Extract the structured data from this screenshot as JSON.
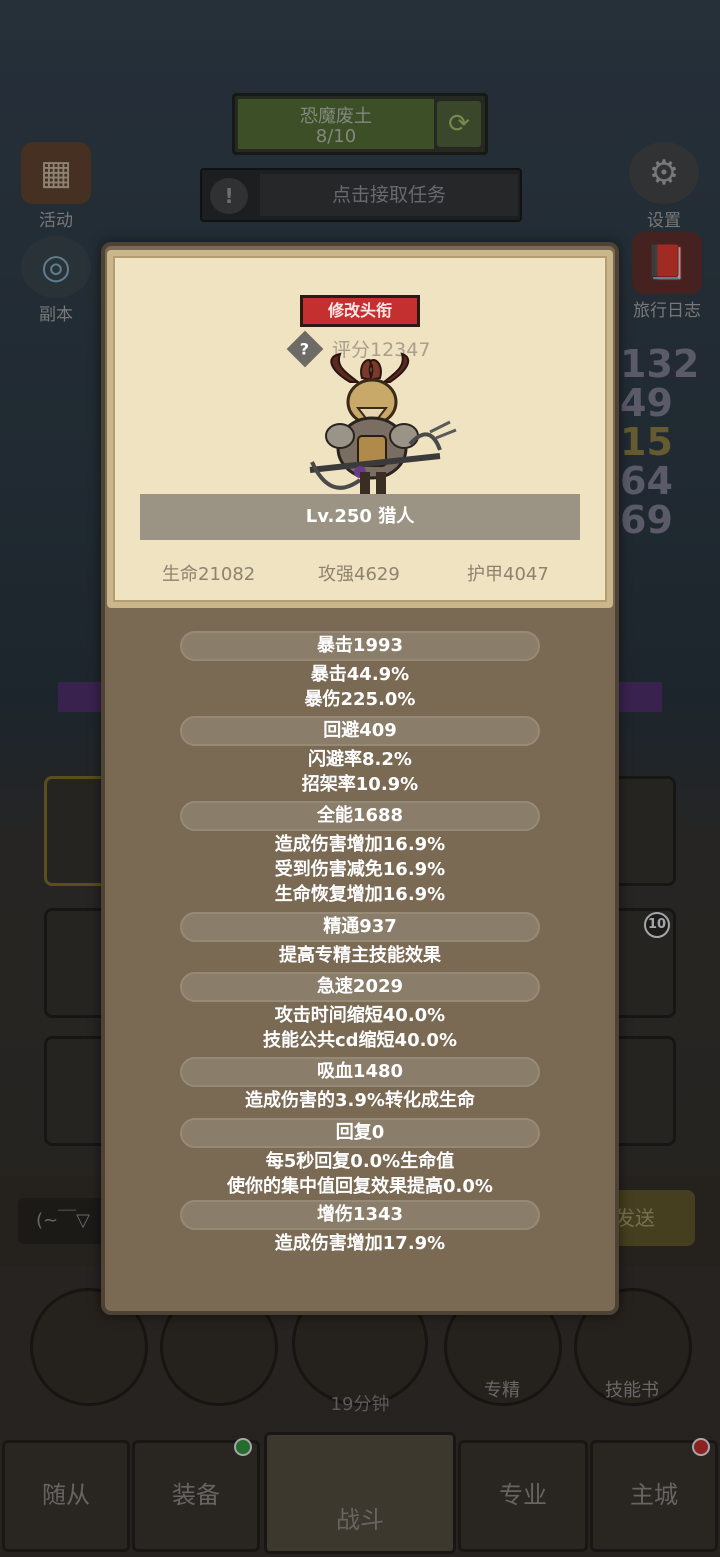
{
  "background": {
    "zone": {
      "name": "恐魔废土",
      "progress": "8/10"
    },
    "quest": {
      "warn": "!",
      "text": "点击接取任务"
    },
    "left_icons": [
      {
        "label": "活动"
      },
      {
        "label": "副本"
      }
    ],
    "right_icons": [
      {
        "label": "设置"
      },
      {
        "label": "旅行日志"
      }
    ],
    "side_numbers": [
      "132",
      "49",
      "15",
      "64",
      "69"
    ],
    "chat": {
      "input_text": "(~￣▽",
      "send_label": "发送"
    },
    "actions": [
      {
        "label": ""
      },
      {
        "label": ""
      },
      {
        "label": "19分钟"
      },
      {
        "label": "专精"
      },
      {
        "label": "技能书"
      }
    ],
    "slot_badge": "10",
    "tabs": [
      {
        "label": "随从"
      },
      {
        "label": "装备"
      },
      {
        "label": "战斗"
      },
      {
        "label": "专业"
      },
      {
        "label": "主城"
      }
    ],
    "colors": {
      "accent_red": "#c43030",
      "panel": "#7a6a54",
      "card": "#efe3c2"
    }
  },
  "hero": {
    "change_title_label": "修改头衔",
    "help_icon": "?",
    "score": "评分12347",
    "level_class": "Lv.250 猎人",
    "base_stats": {
      "hp": "生命21082",
      "attack": "攻强4629",
      "armor": "护甲4047"
    }
  },
  "stats": [
    {
      "header": "暴击1993",
      "lines": [
        "暴击44.9%",
        "暴伤225.0%"
      ]
    },
    {
      "header": "回避409",
      "lines": [
        "闪避率8.2%",
        "招架率10.9%"
      ]
    },
    {
      "header": "全能1688",
      "lines": [
        "造成伤害增加16.9%",
        "受到伤害减免16.9%",
        "生命恢复增加16.9%"
      ]
    },
    {
      "header": "精通937",
      "lines": [
        "提高专精主技能效果"
      ]
    },
    {
      "header": "急速2029",
      "lines": [
        "攻击时间缩短40.0%",
        "技能公共cd缩短40.0%"
      ]
    },
    {
      "header": "吸血1480",
      "lines": [
        "造成伤害的3.9%转化成生命"
      ]
    },
    {
      "header": "回复0",
      "lines": [
        "每5秒回复0.0%生命值",
        "使你的集中值回复效果提高0.0%"
      ]
    },
    {
      "header": "增伤1343",
      "lines": [
        "造成伤害增加17.9%"
      ]
    }
  ]
}
